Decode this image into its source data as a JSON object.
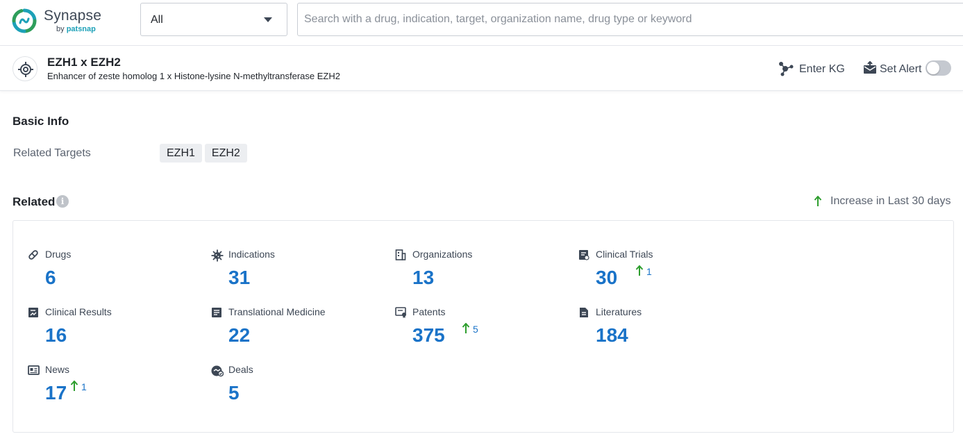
{
  "app": {
    "name": "Synapse",
    "byline_prefix": "by",
    "byline_brand": "patsnap",
    "accent_color": "#1a73c8",
    "increase_color": "#2e9e2e"
  },
  "search": {
    "scope_value": "All",
    "placeholder": "Search with a drug, indication, target, organization name, drug type or keyword",
    "value": ""
  },
  "entity": {
    "icon": "target-icon",
    "title": "EZH1 x EZH2",
    "subtitle": "Enhancer of zeste homolog 1 x Histone-lysine N-methyltransferase EZH2",
    "kg_label": "Enter KG",
    "alert_label": "Set Alert",
    "alert_enabled": false
  },
  "basic_info": {
    "title": "Basic Info",
    "related_targets_label": "Related Targets",
    "related_targets": [
      "EZH1",
      "EZH2"
    ]
  },
  "related": {
    "title": "Related",
    "info_glyph": "i",
    "legend_label": "Increase in Last 30 days",
    "stats": [
      {
        "key": "drugs",
        "label": "Drugs",
        "icon": "pill-icon",
        "value": "6",
        "increase": ""
      },
      {
        "key": "indications",
        "label": "Indications",
        "icon": "virus-icon",
        "value": "31",
        "increase": ""
      },
      {
        "key": "organizations",
        "label": "Organizations",
        "icon": "building-icon",
        "value": "13",
        "increase": ""
      },
      {
        "key": "clinical_trials",
        "label": "Clinical Trials",
        "icon": "clipboard-icon",
        "value": "30",
        "increase": "1"
      },
      {
        "key": "clinical_results",
        "label": "Clinical Results",
        "icon": "chart-report-icon",
        "value": "16",
        "increase": ""
      },
      {
        "key": "translational_medicine",
        "label": "Translational Medicine",
        "icon": "document-list-icon",
        "value": "22",
        "increase": ""
      },
      {
        "key": "patents",
        "label": "Patents",
        "icon": "certificate-icon",
        "value": "375",
        "increase": "5"
      },
      {
        "key": "literatures",
        "label": "Literatures",
        "icon": "file-text-icon",
        "value": "184",
        "increase": ""
      },
      {
        "key": "news",
        "label": "News",
        "icon": "newspaper-icon",
        "value": "17",
        "increase": "1"
      },
      {
        "key": "deals",
        "label": "Deals",
        "icon": "handshake-icon",
        "value": "5",
        "increase": ""
      }
    ]
  }
}
